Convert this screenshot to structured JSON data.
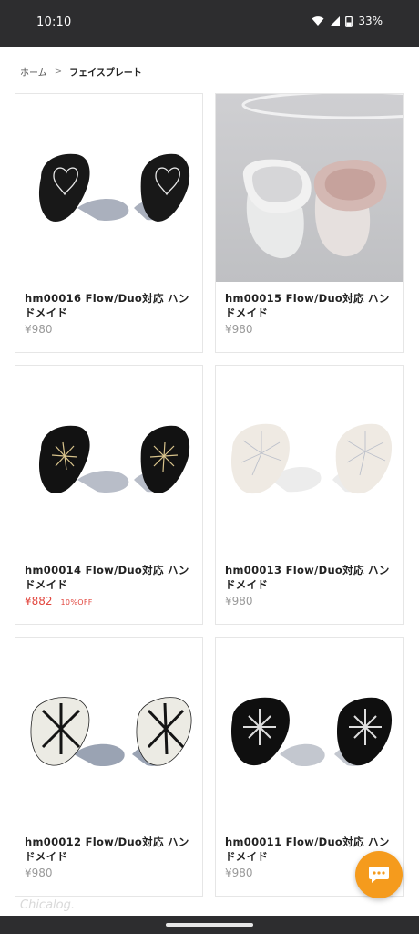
{
  "status": {
    "time": "10:10",
    "battery": "33%"
  },
  "breadcrumb": {
    "home": "ホーム",
    "current": "フェイスプレート"
  },
  "products": [
    {
      "title": "hm00016 Flow/Duo対応 ハンドメイド",
      "price": "¥980",
      "sale": false,
      "discount": ""
    },
    {
      "title": "hm00015 Flow/Duo対応 ハンドメイド",
      "price": "¥980",
      "sale": false,
      "discount": ""
    },
    {
      "title": "hm00014 Flow/Duo対応 ハンドメイド",
      "price": "¥882",
      "sale": true,
      "discount": "10%OFF"
    },
    {
      "title": "hm00013 Flow/Duo対応 ハンドメイド",
      "price": "¥980",
      "sale": false,
      "discount": ""
    },
    {
      "title": "hm00012 Flow/Duo対応 ハンドメイド",
      "price": "¥980",
      "sale": false,
      "discount": ""
    },
    {
      "title": "hm00011 Flow/Duo対応 ハンドメイド",
      "price": "¥980",
      "sale": false,
      "discount": ""
    }
  ],
  "watermark": "Chicalog.",
  "colors": {
    "accent": "#f59b1d",
    "sale": "#e2473f",
    "statusbar": "#2d2d2f"
  },
  "icons": {
    "chat": "chat-bubble-icon",
    "wifi": "wifi-icon",
    "signal": "signal-icon",
    "battery": "battery-icon"
  }
}
